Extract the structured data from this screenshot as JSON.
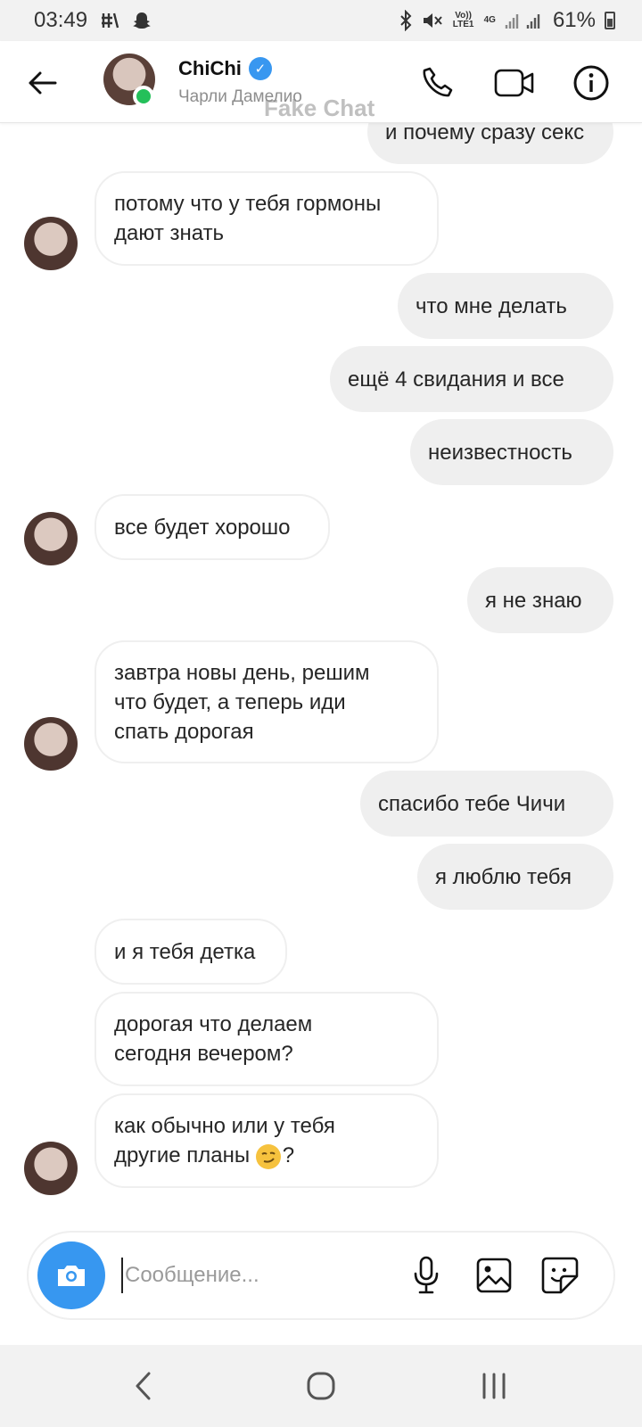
{
  "status_bar": {
    "time": "03:49",
    "network_volte": "Vo)) LTE1",
    "network_type": "4G",
    "battery": "61%"
  },
  "header": {
    "name": "ChiChi",
    "subtitle": "Чарли Дамелио",
    "watermark": "Fake Chat"
  },
  "messages": [
    {
      "dir": "out",
      "text": "и почему сразу секс"
    },
    {
      "dir": "in",
      "text": "потому что у тебя гормоны\nдают знать"
    },
    {
      "dir": "out",
      "text": "что мне делать"
    },
    {
      "dir": "out",
      "text": "ещё 4 свидания и все"
    },
    {
      "dir": "out",
      "text": "неизвестность"
    },
    {
      "dir": "in",
      "text": "все будет хорошо"
    },
    {
      "dir": "out",
      "text": "я не знаю"
    },
    {
      "dir": "in",
      "text": "завтра новы день, решим\nчто будет, а теперь иди\nспать дорогая"
    },
    {
      "dir": "out",
      "text": "спасибо тебе Чичи"
    },
    {
      "dir": "out",
      "text": "я люблю тебя"
    },
    {
      "dir": "in",
      "text": "и я тебя детка"
    },
    {
      "dir": "in",
      "text": "дорогая что делаем\nсегодня вечером?"
    },
    {
      "dir": "in",
      "text_before_emoji": "как обычно или у тебя\nдругие планы ",
      "emoji": "smirking-face",
      "text_after_emoji": "?"
    }
  ],
  "composer": {
    "placeholder": "Сообщение..."
  },
  "colors": {
    "accent": "#3797f0",
    "online": "#24c05a",
    "outgoing_bubble": "#efefef"
  }
}
